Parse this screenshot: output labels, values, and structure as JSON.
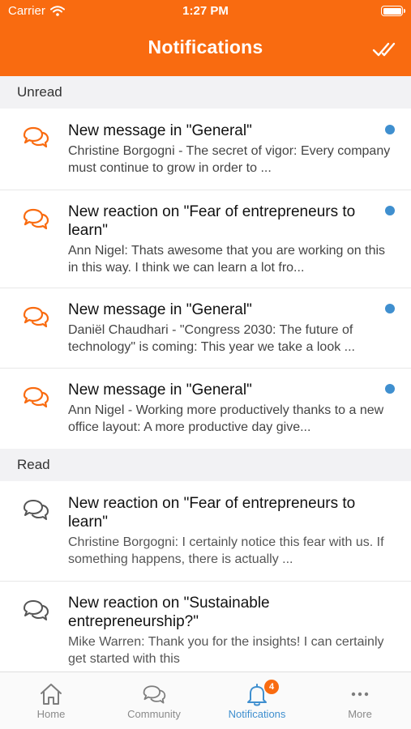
{
  "status_bar": {
    "carrier": "Carrier",
    "time": "1:27 PM"
  },
  "header": {
    "title": "Notifications",
    "mark_all_icon": "double-check-icon"
  },
  "colors": {
    "brand": "#f96b10",
    "unread_dot": "#3f8fcf",
    "read_icon": "#555555"
  },
  "sections": {
    "unread_label": "Unread",
    "read_label": "Read"
  },
  "unread": [
    {
      "title": "New message in \"General\"",
      "body": "Christine Borgogni - The secret of vigor: Every company must continue to grow in order to ..."
    },
    {
      "title": "New reaction on \"Fear of entrepreneurs to learn\"",
      "body": "Ann Nigel: Thats awesome that you are working on this in this way. I think we can learn a lot fro..."
    },
    {
      "title": "New message in \"General\"",
      "body": "Daniël Chaudhari - \"Congress 2030: The future of technology\" is coming: This year we take a look ..."
    },
    {
      "title": "New message in \"General\"",
      "body": "Ann Nigel - Working more productively thanks to a new office layout: A more productive day give..."
    }
  ],
  "read": [
    {
      "title": "New reaction on \"Fear of entrepreneurs to learn\"",
      "body": "Christine Borgogni: I certainly notice this fear with us. If something happens, there is actually ..."
    },
    {
      "title": "New reaction on \"Sustainable entrepreneurship?\"",
      "body": "Mike Warren: Thank you for the insights! I can certainly get started with this"
    }
  ],
  "tabbar": {
    "home": "Home",
    "community": "Community",
    "notifications": "Notifications",
    "notifications_badge": "4",
    "more": "More"
  }
}
